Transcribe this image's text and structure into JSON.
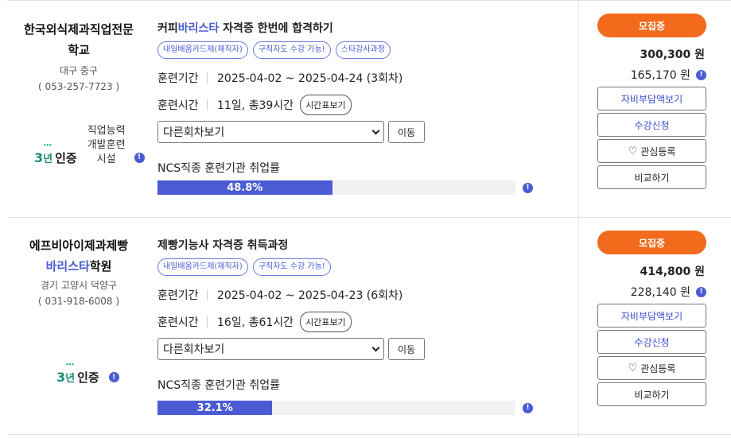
{
  "cards": [
    {
      "institution": {
        "name_a": "한국외식제과직업전문학교",
        "name_b": "",
        "name_c": "",
        "region": "대구 중구",
        "phone": "( 053-257-7723 )"
      },
      "cert": {
        "logo_num": "3",
        "logo_yr": "년",
        "logo_label": "인증",
        "text_lines": [
          "직업능력",
          "개발훈련",
          "시설"
        ],
        "info": "!"
      },
      "course": {
        "title_a": "커피",
        "title_hl": "바리스타",
        "title_b": " 자격증 한번에 합격하기",
        "tags": [
          "내일배움카드제(재직자)",
          "구직자도 수강 가능!",
          "스타강사과정"
        ]
      },
      "period": {
        "label": "훈련기간",
        "value": "2025-04-02 ~ 2025-04-24 (3회차)"
      },
      "time": {
        "label": "훈련시간",
        "value": "11일, 총39시간",
        "button": "시간표보기"
      },
      "select": {
        "value": "다른회차보기",
        "go": "이동"
      },
      "ncs": {
        "label": "NCS직종 훈련기관 취업률",
        "rate": 48.8,
        "rate_text": "48.8%",
        "info": "!"
      },
      "side": {
        "status": "모집중",
        "price": "300,300 원",
        "self_price": "165,170 원",
        "info": "!",
        "btn_self": "자비부담액보기",
        "btn_apply": "수강신청",
        "btn_fav": "관심등록",
        "btn_compare": "비교하기"
      }
    },
    {
      "institution": {
        "name_a": "에프비아이제과제빵",
        "name_b": "바리스타",
        "name_c": "학원",
        "region": "경기 고양시 덕양구",
        "phone": "( 031-918-6008 )"
      },
      "cert": {
        "logo_num": "3",
        "logo_yr": "년",
        "logo_label": "인증",
        "info": "!"
      },
      "course": {
        "title_a": "제빵기능사 자격증 취득과정",
        "title_hl": "",
        "title_b": "",
        "tags": [
          "내일배움카드제(재직자)",
          "구직자도 수강 가능!"
        ]
      },
      "period": {
        "label": "훈련기간",
        "value": "2025-04-02 ~ 2025-04-23 (6회차)"
      },
      "time": {
        "label": "훈련시간",
        "value": "16일, 총61시간",
        "button": "시간표보기"
      },
      "select": {
        "value": "다른회차보기",
        "go": "이동"
      },
      "ncs": {
        "label": "NCS직종 훈련기관 취업률",
        "rate": 32.1,
        "rate_text": "32.1%",
        "info": "!"
      },
      "side": {
        "status": "모집중",
        "price": "414,800 원",
        "self_price": "228,140 원",
        "info": "!",
        "btn_self": "자비부담액보기",
        "btn_apply": "수강신청",
        "btn_fav": "관심등록",
        "btn_compare": "비교하기"
      }
    }
  ],
  "icons": {
    "heart": "heart-outline-icon",
    "info": "info-icon",
    "chevron": "chevron-down-icon"
  },
  "colors": {
    "accent": "#4a5bd4",
    "recruit": "#f26a1b",
    "cert_green": "#1f8a78"
  }
}
